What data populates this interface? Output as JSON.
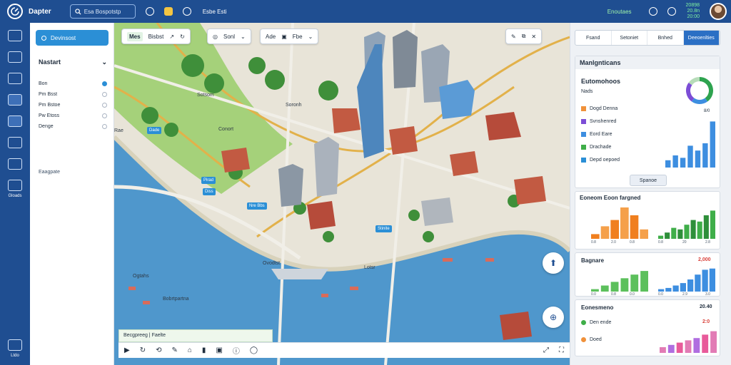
{
  "header": {
    "app_name": "Dapter",
    "search_placeholder": "Esa Bospotstp",
    "links": "Esbe  Esti",
    "status": "Enoutaes",
    "stats": [
      "20898",
      "20.8n",
      "20:00"
    ]
  },
  "rail": {
    "items": [
      "home",
      "layers",
      "search",
      "apps",
      "globe",
      "compass",
      "grid",
      "clock"
    ],
    "label": "Gloads",
    "bottom_label": "Ltdo"
  },
  "sidebar": {
    "button": "Devinsost",
    "section_title": "Nastart",
    "rows": [
      "Bon",
      "Pm Bsst",
      "Pm Bstoe",
      "Pw Etoss",
      "Denge"
    ],
    "sub_label": "Eaagpate"
  },
  "map_toolbar": {
    "tag": "Mes",
    "title": "Bisbst",
    "group2": "Sonl",
    "group3": "Ade",
    "group4": "Fbe"
  },
  "map_labels": [
    "Sotsom",
    "Soronh",
    "Rae",
    "Conort",
    "Ogtahs",
    "Bobrtpartna",
    "Ovodtst",
    "Lotsr"
  ],
  "map_pins": [
    "Dade",
    "Pirad",
    "Nre Bbs",
    "Stinite",
    "Diss"
  ],
  "bottom_bar": "Becgpreeg  |  Faelte",
  "right": {
    "tabs": [
      "Fsand",
      "Setoniet",
      "Bnhed",
      "Deeoenlties"
    ],
    "panel1": {
      "title": "Manlgnticans",
      "subtitle": "Eutomohoos",
      "status": "Nads",
      "legend": [
        {
          "label": "Dogd Denna",
          "color": "#f0913a"
        },
        {
          "label": "Svnshenred",
          "color": "#7c4dd6"
        },
        {
          "label": "Eord Eare",
          "color": "#3d8ee0"
        },
        {
          "label": "Drachade",
          "color": "#3fae49"
        },
        {
          "label": "Depd oepoed",
          "color": "#2b8fd6"
        }
      ],
      "button": "Spanoe",
      "value": "8/0",
      "donut": {
        "values": [
          40,
          20,
          25,
          15
        ],
        "colors": [
          "#2ea34f",
          "#3d8ee0",
          "#7c4dd6",
          "#b7dcb9"
        ]
      },
      "bars": [
        0.15,
        0.25,
        0.2,
        0.45,
        0.35,
        0.5,
        0.95
      ]
    },
    "panel2": {
      "title": "Eoneom Eoon fargned",
      "orange_bars": [
        0.15,
        0.4,
        0.6,
        1.0,
        0.75,
        0.3
      ],
      "green_bars": [
        0.1,
        0.2,
        0.35,
        0.3,
        0.45,
        0.6,
        0.55,
        0.75,
        0.9
      ],
      "ticks": [
        "0.8",
        "2.0",
        "0.8",
        "0.8",
        "20",
        "2.8"
      ]
    },
    "panel3": {
      "title": "Bagnare",
      "value": "2,000",
      "green_bars": [
        0.1,
        0.25,
        0.4,
        0.55,
        0.7,
        0.85
      ],
      "blue_bars": [
        0.1,
        0.15,
        0.25,
        0.35,
        0.5,
        0.7,
        0.9,
        0.95
      ],
      "ticks": [
        "0.0",
        "0.8",
        "0.0",
        "0.0",
        "2.9",
        "3.0"
      ]
    },
    "panel4": {
      "title": "Eonesmeno",
      "value": "20.40",
      "row1": "Den ende",
      "row1_val": "2:0",
      "row2": "Doed",
      "bars": [
        0.25,
        0.35,
        0.45,
        0.55,
        0.65,
        0.8,
        0.95
      ]
    }
  }
}
